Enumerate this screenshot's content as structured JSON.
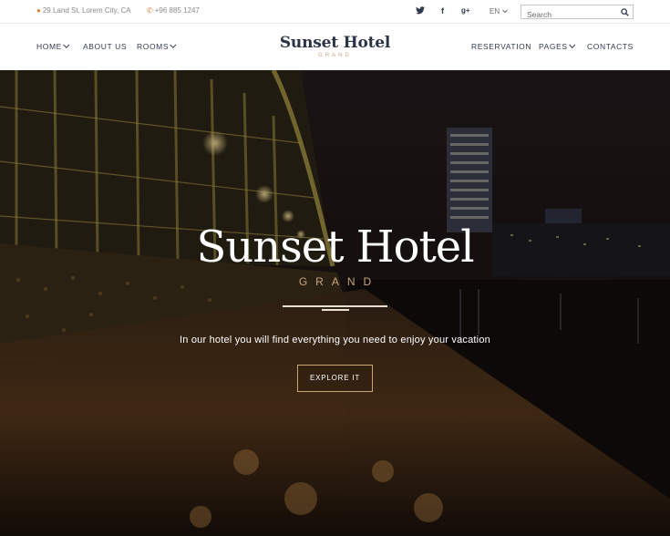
{
  "topbar": {
    "address": "29 Land St, Lorem City, CA",
    "phone": "+96 885 1247",
    "social": {
      "twitter": "twitter-icon",
      "facebook": "facebook-icon",
      "googleplus": "google-plus-icon"
    },
    "twitter_glyph": "🐦",
    "facebook_glyph": "f",
    "googleplus_glyph": "g+",
    "language": "EN",
    "search_placeholder": "Search"
  },
  "nav": {
    "left": [
      {
        "label": "HOME",
        "dropdown": true
      },
      {
        "label": "ABOUT US",
        "dropdown": false
      },
      {
        "label": "ROOMS",
        "dropdown": true
      }
    ],
    "right": [
      {
        "label": "RESERVATION",
        "dropdown": false
      },
      {
        "label": "PAGES",
        "dropdown": true
      },
      {
        "label": "CONTACTS",
        "dropdown": false
      }
    ]
  },
  "brand": {
    "name": "Sunset Hotel",
    "sub": "GRAND"
  },
  "hero": {
    "title": "Sunset Hotel",
    "subtitle": "GRAND",
    "text": "In our hotel you will find everything you need to enjoy your vacation",
    "button": "EXPLORE IT"
  },
  "colors": {
    "accent": "#c9a57a",
    "dark": "#2f3b4c",
    "pin": "#d9843a"
  }
}
